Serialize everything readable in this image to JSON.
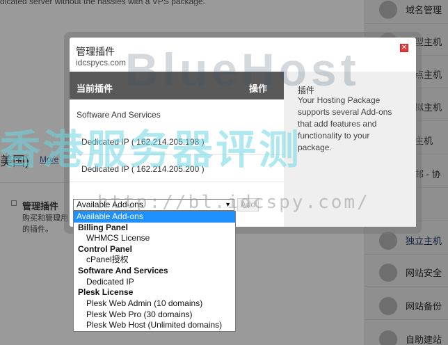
{
  "background": {
    "top_text": "dicated server without the hassles with a VPS package.",
    "left_text": "美国)",
    "more_link": "More",
    "plugin_title": "管理插件",
    "plugin_desc": "购买和管理用的插件。",
    "sidebar": [
      {
        "label": "域名管理",
        "icon": "www-globe-icon"
      },
      {
        "label": "人型主机",
        "icon": "server-icon"
      },
      {
        "label": "站点主机",
        "icon": "server-icon"
      },
      {
        "label": "虚拟主机",
        "icon": "server-icon"
      },
      {
        "label": "消主机",
        "icon": "server-icon"
      },
      {
        "label": "球邮 - 协",
        "icon": "mail-icon"
      },
      {
        "label": "s",
        "icon": "server-icon"
      },
      {
        "label": "独立主机",
        "icon": "dedicated-server-icon"
      },
      {
        "label": "网站安全",
        "icon": "lock-icon"
      },
      {
        "label": "网站备份",
        "icon": "shield-g-icon"
      },
      {
        "label": "自助建站",
        "icon": "builder-icon"
      }
    ]
  },
  "watermark": {
    "brand": "BlueHost",
    "cn": "香港服务器评测",
    "url": "http://bl.idcspy.com/"
  },
  "modal": {
    "title": "管理插件",
    "subtitle": "idcspycs.com",
    "close_icon": "close-icon",
    "table_header": {
      "col1": "当前插件",
      "col2": "操作"
    },
    "group_label": "Software And Services",
    "rows": [
      "Dedicated IP ( 162.214.205.198 )",
      "Dedicated IP ( 162.214.205.200 )"
    ],
    "info": {
      "title": "插件",
      "description": "Your Hosting Package supports several Add-ons that add features and functionality to your package."
    },
    "select_value": "Available Add-ons",
    "add_button": "Add"
  },
  "dropdown": {
    "items": [
      {
        "text": "Available Add-ons",
        "kind": "selected"
      },
      {
        "text": "Billing Panel",
        "kind": "group"
      },
      {
        "text": "WHMCS License",
        "kind": "option"
      },
      {
        "text": "Control Panel",
        "kind": "group"
      },
      {
        "text": "cPanel授权",
        "kind": "option"
      },
      {
        "text": "Software And Services",
        "kind": "group"
      },
      {
        "text": "Dedicated IP",
        "kind": "option"
      },
      {
        "text": "Plesk License",
        "kind": "group"
      },
      {
        "text": "Plesk Web Admin (10 domains)",
        "kind": "option"
      },
      {
        "text": "Plesk Web Pro (30 domains)",
        "kind": "option"
      },
      {
        "text": "Plesk Web Host (Unlimited domains)",
        "kind": "option"
      }
    ]
  }
}
